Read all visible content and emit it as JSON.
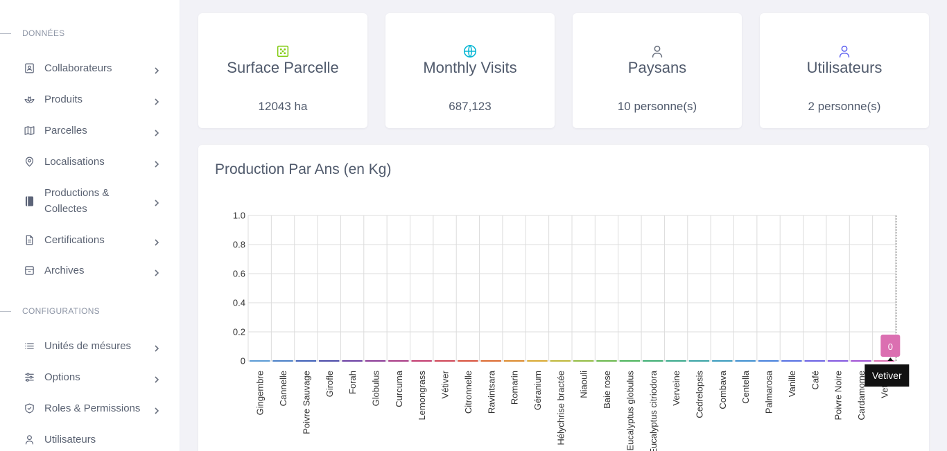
{
  "sidebar": {
    "sections": [
      {
        "label": "DONNÉES",
        "items": [
          {
            "label": "Collaborateurs",
            "icon": "contact-card-icon"
          },
          {
            "label": "Produits",
            "icon": "lotus-icon"
          },
          {
            "label": "Parcelles",
            "icon": "map-icon"
          },
          {
            "label": "Localisations",
            "icon": "map-pin-icon"
          },
          {
            "label": "Productions & Collectes",
            "icon": "book-icon"
          },
          {
            "label": "Certifications",
            "icon": "document-icon"
          },
          {
            "label": "Archives",
            "icon": "archive-box-icon"
          }
        ]
      },
      {
        "label": "CONFIGURATIONS",
        "items": [
          {
            "label": "Unités de mésures",
            "icon": "list-icon"
          },
          {
            "label": "Options",
            "icon": "sliders-icon"
          },
          {
            "label": "Roles & Permissions",
            "icon": "shield-check-icon"
          },
          {
            "label": "Utilisateurs",
            "icon": "user-icon"
          }
        ]
      }
    ]
  },
  "stats": [
    {
      "title": "Surface Parcelle",
      "value": "12043 ha",
      "icon": "grid-square-icon",
      "color": "#84cc16"
    },
    {
      "title": "Monthly Visits",
      "value": "687,123",
      "icon": "globe-icon",
      "color": "#06b6d4"
    },
    {
      "title": "Paysans",
      "value": "10 personne(s)",
      "icon": "user-icon",
      "color": "#6b7280"
    },
    {
      "title": "Utilisateurs",
      "value": "2 personne(s)",
      "icon": "user-icon",
      "color": "#6366f1"
    }
  ],
  "chart": {
    "title": "Production Par Ans (en Kg)",
    "tooltip": {
      "value": "0",
      "label": "Vetiver",
      "color": "#db6fb1"
    }
  },
  "chart_data": {
    "type": "line",
    "title": "Production Par Ans (en Kg)",
    "categories": [
      "Gingembre",
      "Cannelle",
      "Poivre Sauvage",
      "Girofle",
      "Forah",
      "Globulus",
      "Curcuma",
      "Lemongrass",
      "Vétiver",
      "Citronnelle",
      "Ravintsara",
      "Romarin",
      "Géranium",
      "Hélychrise bractée",
      "Niaouli",
      "Baie rose",
      "Eucalyptus globulus",
      "Eucalyptus citriodora",
      "Verveine",
      "Cedrelopsis",
      "Combava",
      "Centella",
      "Palmarosa",
      "Vanille",
      "Café",
      "Poivre Noire",
      "Cardamome",
      "Vetiver"
    ],
    "values": [
      0,
      0,
      0,
      0,
      0,
      0,
      0,
      0,
      0,
      0,
      0,
      0,
      0,
      0,
      0,
      0,
      0,
      0,
      0,
      0,
      0,
      0,
      0,
      0,
      0,
      0,
      0,
      0
    ],
    "ylim": [
      0,
      1
    ],
    "yticks": [
      "0",
      "0.2",
      "0.4",
      "0.6",
      "0.8",
      "1.0"
    ],
    "grid": true
  }
}
